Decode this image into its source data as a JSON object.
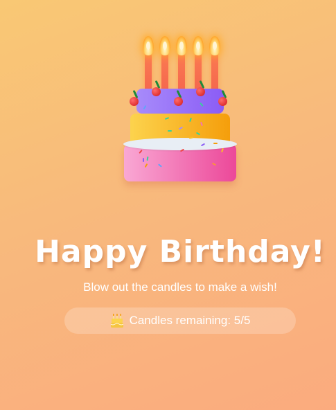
{
  "header": {
    "title": "Happy Birthday!",
    "subtitle": "Blow out the candles to make a wish!"
  },
  "status": {
    "label_prefix": "Candles remaining: ",
    "remaining": 5,
    "total": 5,
    "text": "Candles remaining: 5/5",
    "icon": "birthday-cake-icon"
  },
  "cake": {
    "candle_count": 5,
    "candles_lit": [
      true,
      true,
      true,
      true,
      true
    ],
    "colors": {
      "candle": "#f05a4a",
      "flame": "#ffb02e",
      "tier_top": "#8b5cf6",
      "tier_middle": "#f59e0b",
      "tier_bottom": "#ec4899",
      "frosting": "#e8eef5",
      "cherry": "#e03131"
    }
  },
  "theme": {
    "background_start": "#f9c874",
    "background_end": "#fbab7e",
    "text": "#ffffff"
  }
}
